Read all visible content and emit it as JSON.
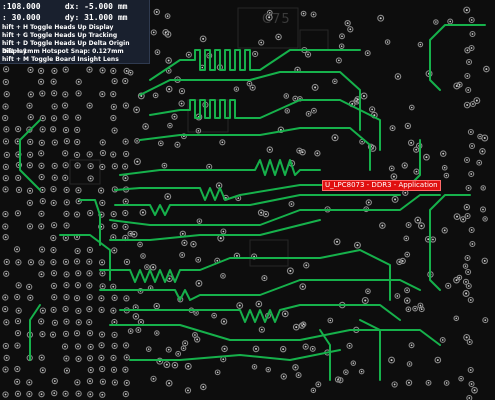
{
  "hud": {
    "line1": {
      "x": ":108.000",
      "dx": "dx: -5.000",
      "unit": "mm"
    },
    "line2": {
      "y": ": 30.000",
      "dy": "dy: 31.000",
      "unit": "mm"
    },
    "hints": [
      "hift + H  Toggle Heads Up Display",
      "hift + G  Toggle Heads Up Tracking",
      "hift + D  Toggle Heads Up Delta Origin Display",
      "hift + 1mm Hotspot Snap: 0.127mm",
      "hift + M  Toggle Board Insight Lens"
    ]
  },
  "net_label": "U_LPC8073 - DDR3 - Application",
  "silkscreen": {
    "designator": "C75"
  },
  "colors": {
    "board": "#0d0d0d",
    "trace": "#16b14b",
    "pad": "#8a8a8a",
    "net_highlight": "#e01010",
    "hud_bg": "#1e283c"
  }
}
